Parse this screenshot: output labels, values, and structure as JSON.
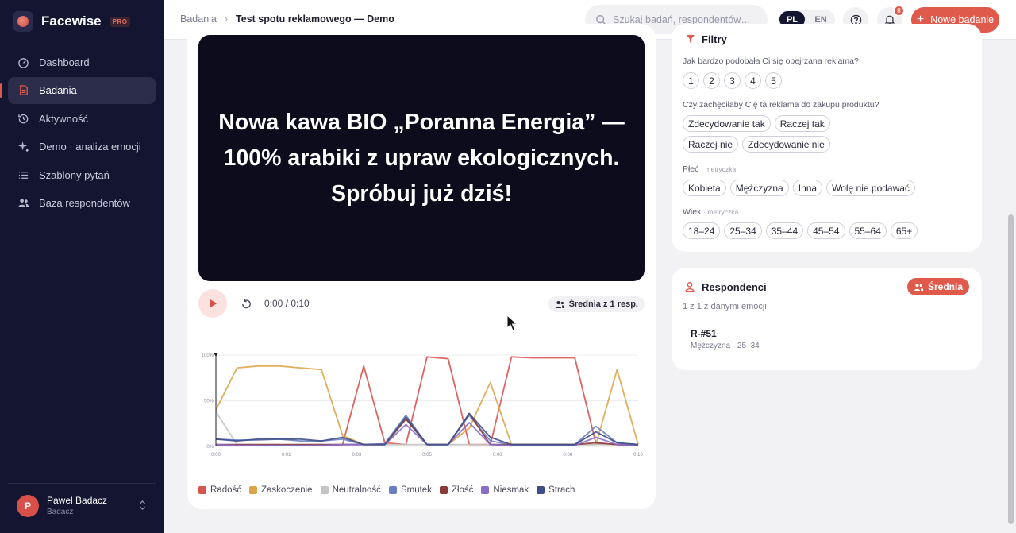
{
  "brand": {
    "name": "Facewise",
    "badge": "PRO"
  },
  "sidebar": {
    "items": [
      {
        "label": "Dashboard",
        "icon": "gauge-icon"
      },
      {
        "label": "Badania",
        "icon": "document-icon",
        "active": true
      },
      {
        "label": "Aktywność",
        "icon": "history-icon"
      },
      {
        "label": "Demo · analiza emocji",
        "icon": "sparkle-icon"
      },
      {
        "label": "Szablony pytań",
        "icon": "list-icon"
      },
      {
        "label": "Baza respondentów",
        "icon": "users-icon"
      }
    ],
    "user": {
      "initial": "P",
      "name": "Pawel Badacz",
      "role": "Badacz"
    }
  },
  "header": {
    "breadcrumb_root": "Badania",
    "breadcrumb_current": "Test spotu reklamowego — Demo",
    "search_placeholder": "Szukaj badań, respondentów…",
    "lang_pl": "PL",
    "lang_en": "EN",
    "notifications_count": "8",
    "new_button": "Nowe badanie"
  },
  "video": {
    "line1": "Nowa kawa BIO „Poranna Energia” —",
    "line2": "100% arabiki z upraw ekologicznych.",
    "line3": "Spróbuj już dziś!",
    "time": "0:00 / 0:10",
    "average_chip": "Średnia z 1 resp."
  },
  "colors": {
    "accent": "#e05a4c",
    "sidebar_bg": "#141530",
    "radosc": "#d9534f",
    "zaskoczenie": "#dba64a",
    "neutralnosc": "#c4c4c4",
    "smutek": "#6b7fc0",
    "zlosc": "#8b3a3a",
    "niesmak": "#8a6cc9",
    "strach": "#3e4f88"
  },
  "chart_data": {
    "type": "line",
    "y_ticks": [
      "100%",
      "50%",
      "0%"
    ],
    "x_ticks": [
      "0:00",
      "0:01",
      "0:03",
      "0:05",
      "0:06",
      "0:08",
      "0:10"
    ],
    "xlim": [
      0,
      10
    ],
    "ylim": [
      0,
      100
    ],
    "x": [
      0,
      0.5,
      1,
      1.5,
      2,
      2.5,
      3,
      3.5,
      4,
      4.5,
      5,
      5.5,
      6,
      6.5,
      7,
      7.5,
      8,
      8.5,
      9,
      9.5,
      10
    ],
    "series": [
      {
        "name": "Radość",
        "values": [
          1,
          1,
          1,
          1,
          1,
          1,
          2,
          88,
          4,
          2,
          98,
          96,
          2,
          2,
          98,
          97,
          97,
          97,
          3,
          2,
          1
        ]
      },
      {
        "name": "Zaskoczenie",
        "values": [
          40,
          86,
          88,
          88,
          86,
          84,
          12,
          2,
          2,
          30,
          2,
          2,
          20,
          70,
          2,
          2,
          2,
          2,
          2,
          84,
          2
        ]
      },
      {
        "name": "Neutralność",
        "values": [
          38,
          2,
          2,
          2,
          2,
          2,
          2,
          2,
          2,
          2,
          2,
          2,
          2,
          2,
          2,
          2,
          2,
          2,
          2,
          2,
          2
        ]
      },
      {
        "name": "Smutek",
        "values": [
          8,
          7,
          7,
          8,
          6,
          6,
          8,
          2,
          3,
          34,
          2,
          2,
          34,
          6,
          2,
          2,
          2,
          2,
          22,
          4,
          2
        ]
      },
      {
        "name": "Złość",
        "values": [
          2,
          2,
          2,
          2,
          2,
          2,
          2,
          2,
          2,
          30,
          2,
          2,
          36,
          2,
          2,
          2,
          2,
          2,
          4,
          2,
          1
        ]
      },
      {
        "name": "Niesmak",
        "values": [
          2,
          1,
          1,
          1,
          1,
          1,
          2,
          2,
          2,
          24,
          2,
          2,
          26,
          2,
          1,
          1,
          1,
          1,
          10,
          2,
          1
        ]
      },
      {
        "name": "Strach",
        "values": [
          8,
          6,
          8,
          8,
          8,
          6,
          10,
          2,
          2,
          32,
          2,
          2,
          36,
          10,
          2,
          2,
          2,
          2,
          16,
          4,
          2
        ]
      }
    ]
  },
  "filters": {
    "title": "Filtry",
    "q1": {
      "label": "Jak bardzo podobała Ci się obejrzana reklama?",
      "options": [
        "1",
        "2",
        "3",
        "4",
        "5"
      ]
    },
    "q2": {
      "label": "Czy zachęciłaby Cię ta reklama do zakupu produktu?",
      "options": [
        "Zdecydowanie tak",
        "Raczej tak",
        "Raczej nie",
        "Zdecydowanie nie"
      ]
    },
    "q3": {
      "label": "Płeć",
      "sub": "· metryczka",
      "options": [
        "Kobieta",
        "Mężczyzna",
        "Inna",
        "Wolę nie podawać"
      ]
    },
    "q4": {
      "label": "Wiek",
      "sub": "· metryczka",
      "options": [
        "18–24",
        "25–34",
        "35–44",
        "45–54",
        "55–64",
        "65+"
      ]
    }
  },
  "respondents": {
    "title": "Respondenci",
    "badge": "Średnia",
    "subtitle": "1 z 1 z danymi emocji",
    "items": [
      {
        "id": "R-#51",
        "meta": "Mężczyzna · 25–34"
      }
    ]
  }
}
